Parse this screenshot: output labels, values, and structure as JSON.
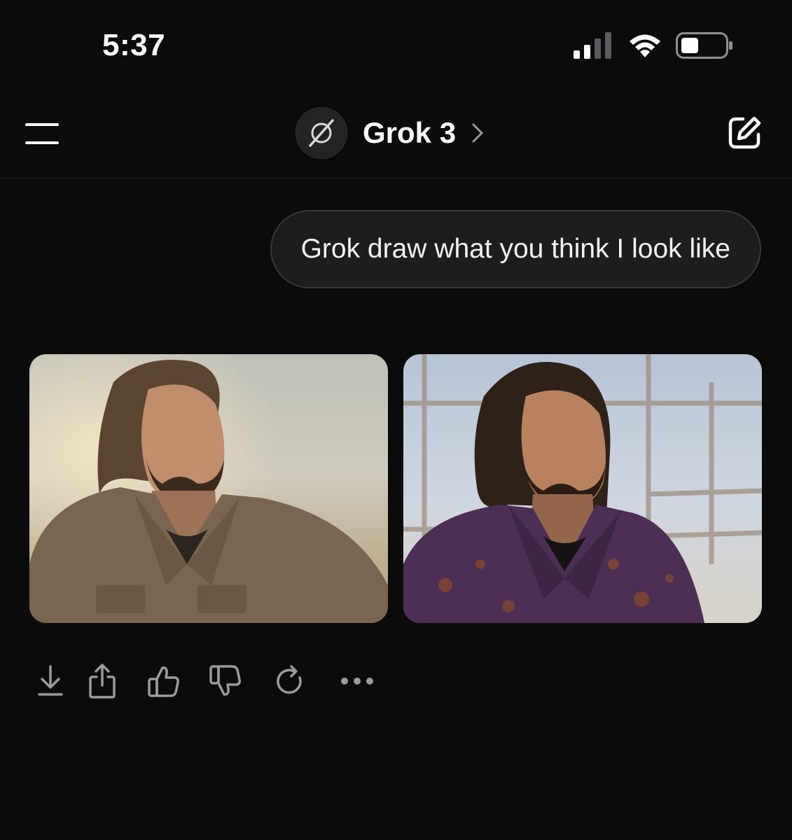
{
  "status_bar": {
    "time": "5:37",
    "signal_icon": "cellular-signal-icon",
    "wifi_icon": "wifi-icon",
    "battery_icon": "battery-icon"
  },
  "header": {
    "menu_icon": "hamburger-menu-icon",
    "logo_icon": "grok-logo-icon",
    "title": "Grok 3",
    "chevron_icon": "chevron-right-icon",
    "compose_icon": "new-chat-icon"
  },
  "conversation": {
    "user_message": "Grok draw what you think I look like",
    "images": [
      {
        "name": "generated-image-1"
      },
      {
        "name": "generated-image-2"
      }
    ]
  },
  "actions": [
    {
      "icon": "download-icon"
    },
    {
      "icon": "share-icon"
    },
    {
      "icon": "thumbs-up-icon"
    },
    {
      "icon": "thumbs-down-icon"
    },
    {
      "icon": "regenerate-icon"
    },
    {
      "icon": "more-icon"
    }
  ],
  "colors": {
    "background": "#0b0b0c",
    "bubble": "#1d1d1f",
    "icon_gray": "#9a9a9f"
  }
}
